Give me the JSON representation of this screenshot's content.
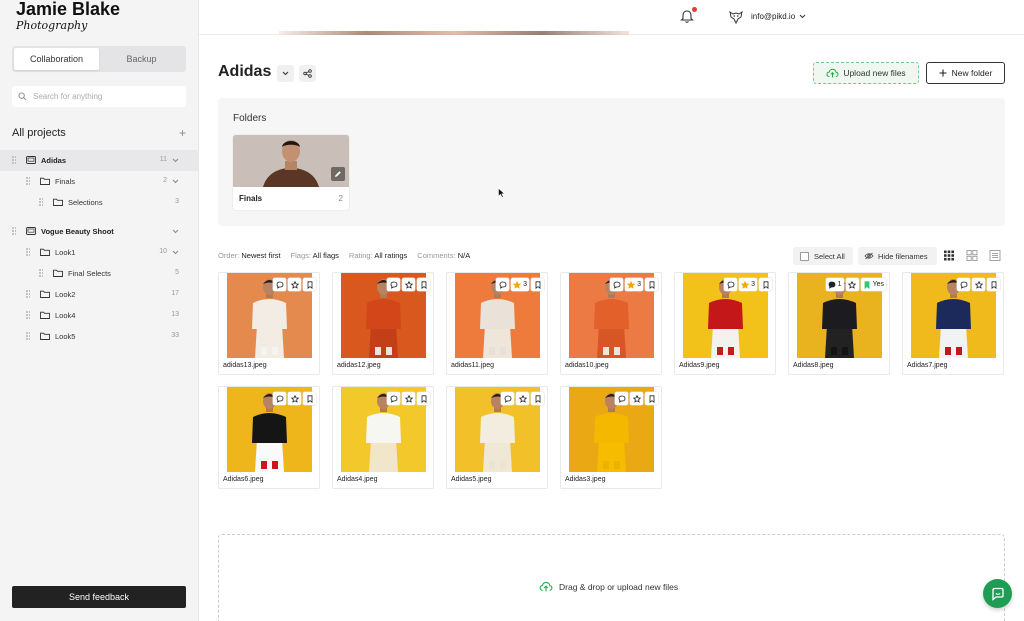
{
  "brand": {
    "name": "Jamie Blake",
    "subtitle": "Photography"
  },
  "sidebar": {
    "tabs": [
      {
        "label": "Collaboration",
        "active": true
      },
      {
        "label": "Backup",
        "active": false
      }
    ],
    "search_placeholder": "Search for anything",
    "all_projects_label": "All projects",
    "add_icon": "plus-icon",
    "tree": [
      {
        "label": "Adidas",
        "count": "11",
        "level": 0,
        "icon": "project-icon",
        "selected": true,
        "expanded": true
      },
      {
        "label": "Finals",
        "count": "2",
        "level": 1,
        "icon": "folder-icon",
        "expanded": true
      },
      {
        "label": "Selections",
        "count": "3",
        "level": 2,
        "icon": "folder-icon"
      },
      {
        "label": "Vogue Beauty Shoot",
        "count": "",
        "level": 0,
        "icon": "project-icon",
        "expanded": true
      },
      {
        "label": "Look1",
        "count": "10",
        "level": 1,
        "icon": "folder-icon",
        "expanded": true
      },
      {
        "label": "Final Selects",
        "count": "5",
        "level": 2,
        "icon": "folder-icon"
      },
      {
        "label": "Look2",
        "count": "17",
        "level": 1,
        "icon": "folder-icon"
      },
      {
        "label": "Look4",
        "count": "13",
        "level": 1,
        "icon": "folder-icon"
      },
      {
        "label": "Look5",
        "count": "33",
        "level": 1,
        "icon": "folder-icon"
      }
    ],
    "feedback_label": "Send feedback"
  },
  "topbar": {
    "account_email": "info@pikd.io",
    "notification_icon": "bell-icon"
  },
  "page": {
    "title": "Adidas",
    "upload_label": "Upload new files",
    "new_folder_label": "New folder"
  },
  "folders": {
    "heading": "Folders",
    "items": [
      {
        "name": "Finals",
        "count": "2"
      }
    ]
  },
  "filters": {
    "order_key": "Order:",
    "order_value": "Newest first",
    "flags_key": "Flags:",
    "flags_value": "All flags",
    "rating_key": "Rating:",
    "rating_value": "All ratings",
    "comments_key": "Comments:",
    "comments_value": "N/A",
    "select_all_label": "Select All",
    "hide_filenames_label": "Hide filenames"
  },
  "photos": [
    {
      "filename": "adidas13.jpeg",
      "bg": "#e58a4e",
      "comments": "",
      "stars": "",
      "flag": ""
    },
    {
      "filename": "adidas12.jpeg",
      "bg": "#d8581e",
      "comments": "",
      "stars": "",
      "flag": ""
    },
    {
      "filename": "adidas11.jpeg",
      "bg": "#ee7a3c",
      "comments": "",
      "stars": "3",
      "flag": ""
    },
    {
      "filename": "adidas10.jpeg",
      "bg": "#ec7a44",
      "comments": "",
      "stars": "3",
      "flag": ""
    },
    {
      "filename": "Adidas9.jpeg",
      "bg": "#f2c21a",
      "comments": "",
      "stars": "3",
      "flag": ""
    },
    {
      "filename": "Adidas8.jpeg",
      "bg": "#e9b320",
      "comments": "1",
      "stars": "",
      "flag": "Yes"
    },
    {
      "filename": "Adidas7.jpeg",
      "bg": "#f0ba1c",
      "comments": "",
      "stars": "",
      "flag": ""
    },
    {
      "filename": "Adidas6.jpeg",
      "bg": "#efb61c",
      "comments": "",
      "stars": "",
      "flag": ""
    },
    {
      "filename": "Adidas4.jpeg",
      "bg": "#f3c82a",
      "comments": "",
      "stars": "",
      "flag": ""
    },
    {
      "filename": "Adidas5.jpeg",
      "bg": "#f2c12a",
      "comments": "",
      "stars": "",
      "flag": ""
    },
    {
      "filename": "Adidas3.jpeg",
      "bg": "#e9a814",
      "comments": "",
      "stars": "",
      "flag": ""
    }
  ],
  "dropzone": {
    "label": "Drag & drop or upload new files"
  },
  "colors": {
    "accent_green": "#1f9d55",
    "flag_green": "#2ecc71",
    "star_gold": "#f2a900",
    "notify_red": "#e53935"
  }
}
